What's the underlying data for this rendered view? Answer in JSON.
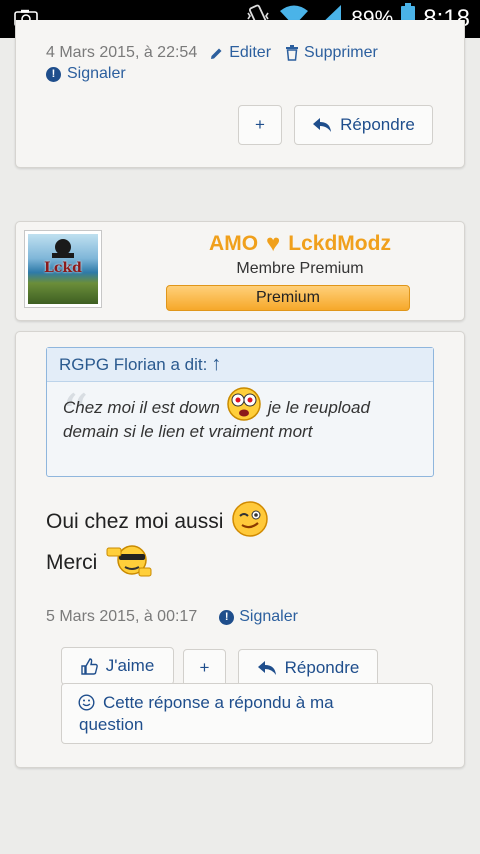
{
  "status_bar": {
    "battery_percent": "89%",
    "time": "8:18",
    "icons": [
      "screenshot-icon",
      "vibrate-icon",
      "wifi-icon",
      "signal-icon",
      "battery-icon"
    ]
  },
  "post1": {
    "date": "4 Mars 2015, à 22:54",
    "edit_label": "Editer",
    "delete_label": "Supprimer",
    "report_label": "Signaler",
    "plus_label": "+",
    "reply_label": "Répondre"
  },
  "user": {
    "name_left": "AMO",
    "name_right": "LckdModz",
    "heart": "♥",
    "title": "Membre Premium",
    "badge": "Premium",
    "avatar_text": "Lckd"
  },
  "post2": {
    "quote_author": "RGPG Florian a dit:",
    "quote_arrow": "↑",
    "quote_line1a": "Chez moi il est down",
    "quote_line1b": "je le reupload",
    "quote_line2": "demain si le lien et vraiment mort",
    "message_line1": "Oui chez moi aussi",
    "message_line2": "Merci",
    "date": "5 Mars 2015, à 00:17",
    "report_label": "Signaler",
    "like_label": "J'aime",
    "plus_label": "+",
    "reply_label": "Répondre",
    "answered_line1": "Cette réponse a répondu à ma",
    "answered_line2": "question"
  }
}
